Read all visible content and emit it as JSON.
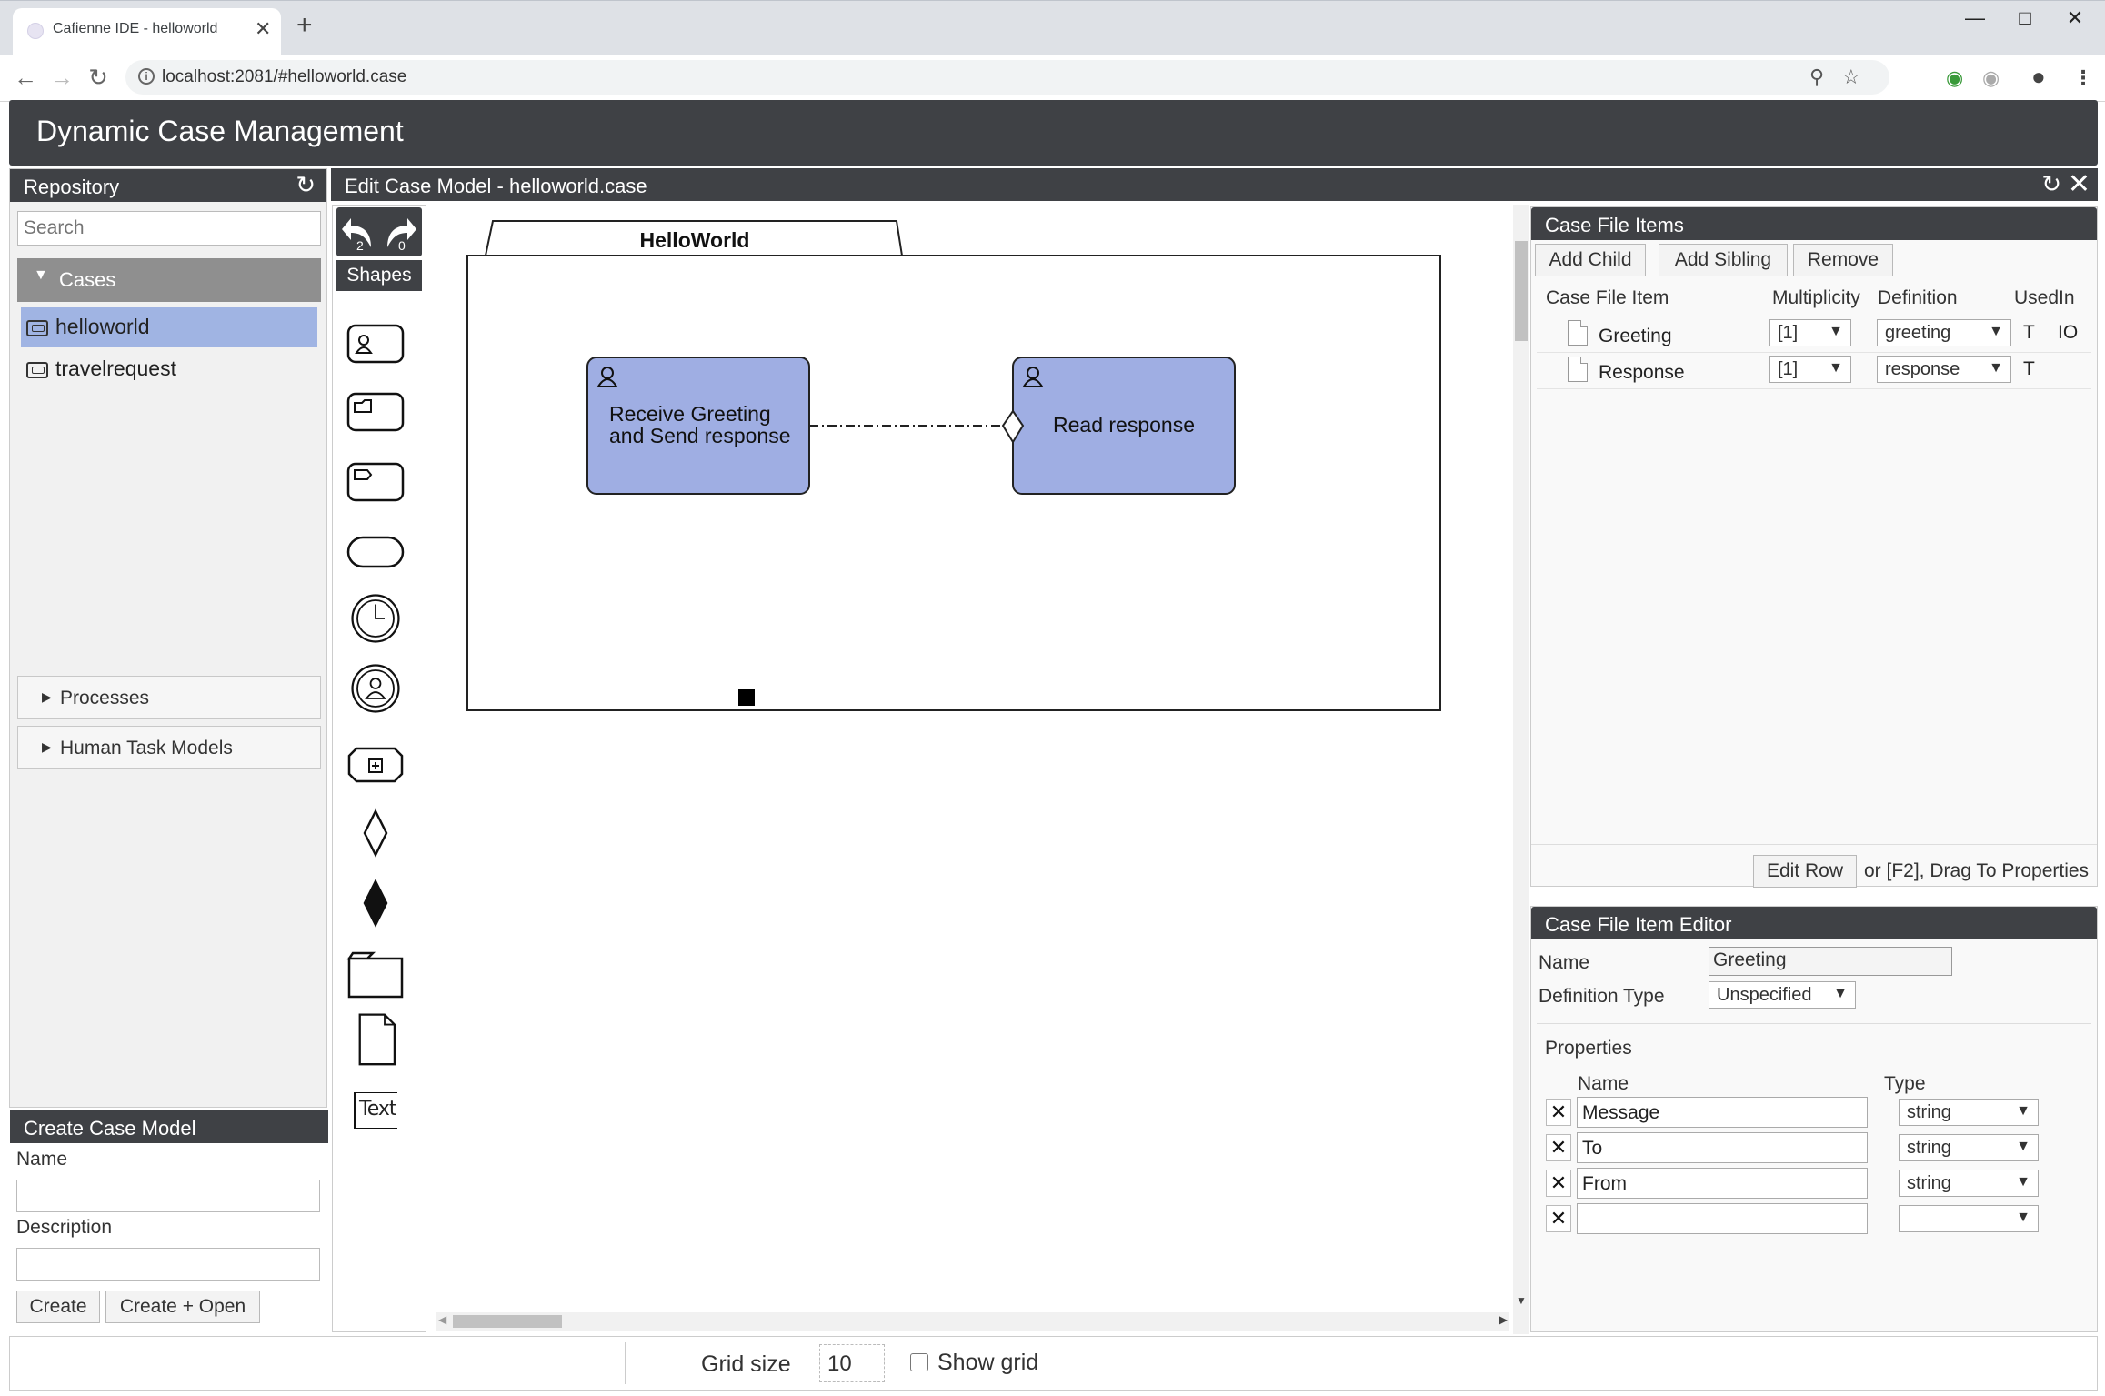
{
  "browser": {
    "tab_title": "Cafienne IDE - helloworld",
    "url": "localhost:2081/#helloworld.case"
  },
  "app": {
    "title": "Dynamic Case Management"
  },
  "repository": {
    "title": "Repository",
    "search_placeholder": "Search",
    "cases_label": "Cases",
    "items": [
      {
        "label": "helloworld",
        "selected": true
      },
      {
        "label": "travelrequest",
        "selected": false
      }
    ],
    "processes_label": "Processes",
    "human_task_models_label": "Human Task Models"
  },
  "create_case_model": {
    "title": "Create Case Model",
    "name_label": "Name",
    "name_value": "",
    "description_label": "Description",
    "description_value": "",
    "create_label": "Create",
    "create_open_label": "Create + Open"
  },
  "editor": {
    "title": "Edit Case Model - helloworld.case",
    "undo_count": "2",
    "redo_count": "0",
    "shapes_label": "Shapes",
    "text_tool_label": "Text",
    "diagram": {
      "case_plan_name": "HelloWorld",
      "task1_label_line1": "Receive Greeting",
      "task1_label_line2": "and Send response",
      "task2_label": "Read response"
    }
  },
  "case_file_items": {
    "title": "Case File Items",
    "add_child_label": "Add Child",
    "add_sibling_label": "Add Sibling",
    "remove_label": "Remove",
    "columns": [
      "Case File Item",
      "Multiplicity",
      "Definition",
      "UsedIn"
    ],
    "rows": [
      {
        "name": "Greeting",
        "multiplicity": "[1]",
        "definition": "greeting",
        "usedin": "T",
        "io": "IO"
      },
      {
        "name": "Response",
        "multiplicity": "[1]",
        "definition": "response",
        "usedin": "T",
        "io": ""
      }
    ],
    "edit_row_label": "Edit Row",
    "hint": "or [F2], Drag To Properties"
  },
  "case_file_item_editor": {
    "title": "Case File Item Editor",
    "name_label": "Name",
    "name_value": "Greeting",
    "definition_type_label": "Definition Type",
    "definition_type_value": "Unspecified",
    "properties_label": "Properties",
    "prop_name_header": "Name",
    "prop_type_header": "Type",
    "properties": [
      {
        "name": "Message",
        "type": "string"
      },
      {
        "name": "To",
        "type": "string"
      },
      {
        "name": "From",
        "type": "string"
      },
      {
        "name": "",
        "type": ""
      }
    ]
  },
  "status_bar": {
    "grid_size_label": "Grid size",
    "grid_size_value": "10",
    "show_grid_label": "Show grid"
  }
}
